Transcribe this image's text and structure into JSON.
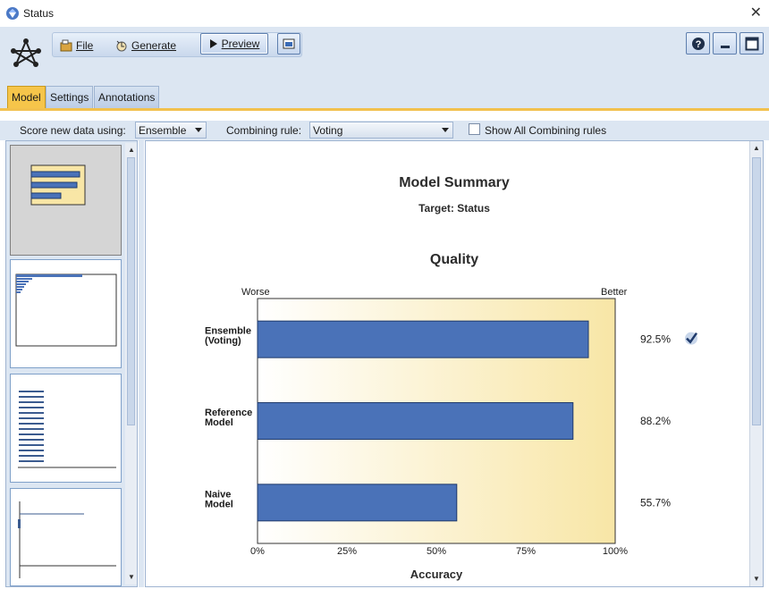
{
  "window": {
    "title": "Status",
    "close_glyph": "✕"
  },
  "toolbar": {
    "file_label": "File",
    "generate_label": "Generate",
    "preview_label": "Preview"
  },
  "tabs": [
    {
      "label": "Model",
      "active": true
    },
    {
      "label": "Settings",
      "active": false
    },
    {
      "label": "Annotations",
      "active": false
    }
  ],
  "options": {
    "score_label": "Score new data using:",
    "score_value": "Ensemble",
    "combining_label": "Combining rule:",
    "combining_value": "Voting",
    "show_all_label": "Show All Combining rules",
    "show_all_checked": false
  },
  "summary": {
    "title": "Model Summary",
    "target": "Target: Status",
    "quality_title": "Quality"
  },
  "chart_data": {
    "type": "bar",
    "orientation": "horizontal",
    "categories": [
      [
        "Ensemble",
        "(Voting)"
      ],
      [
        "Reference",
        "Model"
      ],
      [
        "Naive",
        "Model"
      ]
    ],
    "values": [
      92.5,
      88.2,
      55.7
    ],
    "value_labels": [
      "92.5%",
      "88.2%",
      "55.7%"
    ],
    "best_marker_index": 0,
    "xlim": [
      0,
      100
    ],
    "xticks": [
      "0%",
      "25%",
      "50%",
      "75%",
      "100%"
    ],
    "xlabel": "Accuracy",
    "scale_left_label": "Worse",
    "scale_right_label": "Better",
    "colors": {
      "bar": "#4a72b8",
      "bar_border": "#1f3a6b",
      "bg_start": "#ffffff",
      "bg_end": "#f8e6a6"
    }
  },
  "icons": [
    "diamond-app-icon",
    "network-logo-icon",
    "file-icon",
    "generate-icon",
    "play-icon",
    "export-icon",
    "help-icon",
    "minimize-icon",
    "maximize-icon",
    "check-mark-icon"
  ]
}
